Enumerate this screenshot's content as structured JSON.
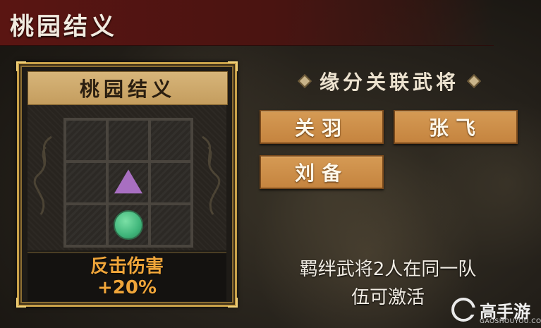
{
  "page": {
    "title": "桃园结义"
  },
  "card": {
    "header": "桃园结义",
    "formation": {
      "rows": 3,
      "cols": 3,
      "markers": [
        {
          "row": 2,
          "col": 2,
          "shape": "triangle",
          "color": "#a86fc1"
        },
        {
          "row": 3,
          "col": 2,
          "shape": "circle",
          "color": "#40b67b"
        }
      ]
    },
    "effect_name": "反击伤害",
    "effect_value": "+20%"
  },
  "related": {
    "title": "缘分关联武将",
    "generals": [
      "关羽",
      "张飞",
      "刘备"
    ]
  },
  "description": {
    "line1": "羁绊武将2人在同一队",
    "line2": "伍可激活"
  },
  "watermark": {
    "name": "高手游",
    "domain": "GAOSHOUYOU.COM"
  },
  "colors": {
    "accent_gold": "#c9a14a",
    "button": "#c98b46",
    "effect_text": "#efa53a",
    "title_bar": "#5a1512"
  }
}
